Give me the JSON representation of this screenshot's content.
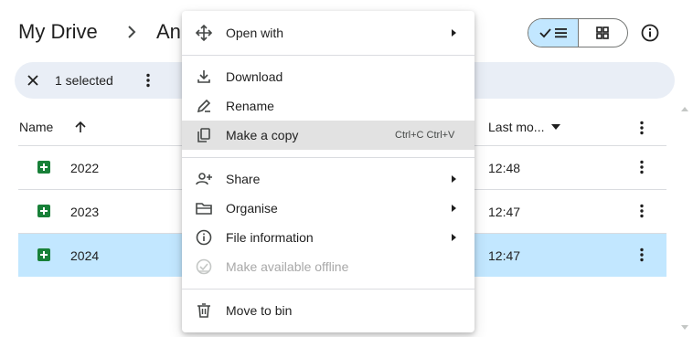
{
  "breadcrumb": {
    "root": "My Drive",
    "current": "An"
  },
  "selection": {
    "count_label": "1 selected"
  },
  "columns": {
    "name": "Name",
    "modified": "Last mo..."
  },
  "files": [
    {
      "name": "2022",
      "time": "12:48",
      "selected": false
    },
    {
      "name": "2023",
      "time": "12:47",
      "selected": false
    },
    {
      "name": "2024",
      "time": "12:47",
      "selected": true
    }
  ],
  "menu": {
    "open_with": "Open with",
    "download": "Download",
    "rename": "Rename",
    "make_copy": "Make a copy",
    "make_copy_shortcut": "Ctrl+C Ctrl+V",
    "share": "Share",
    "organise": "Organise",
    "file_information": "File information",
    "make_offline": "Make available offline",
    "move_to_bin": "Move to bin"
  },
  "colors": {
    "accent": "#c2e7ff",
    "sheets_green": "#188038",
    "selection_bar": "#e9eef6"
  }
}
